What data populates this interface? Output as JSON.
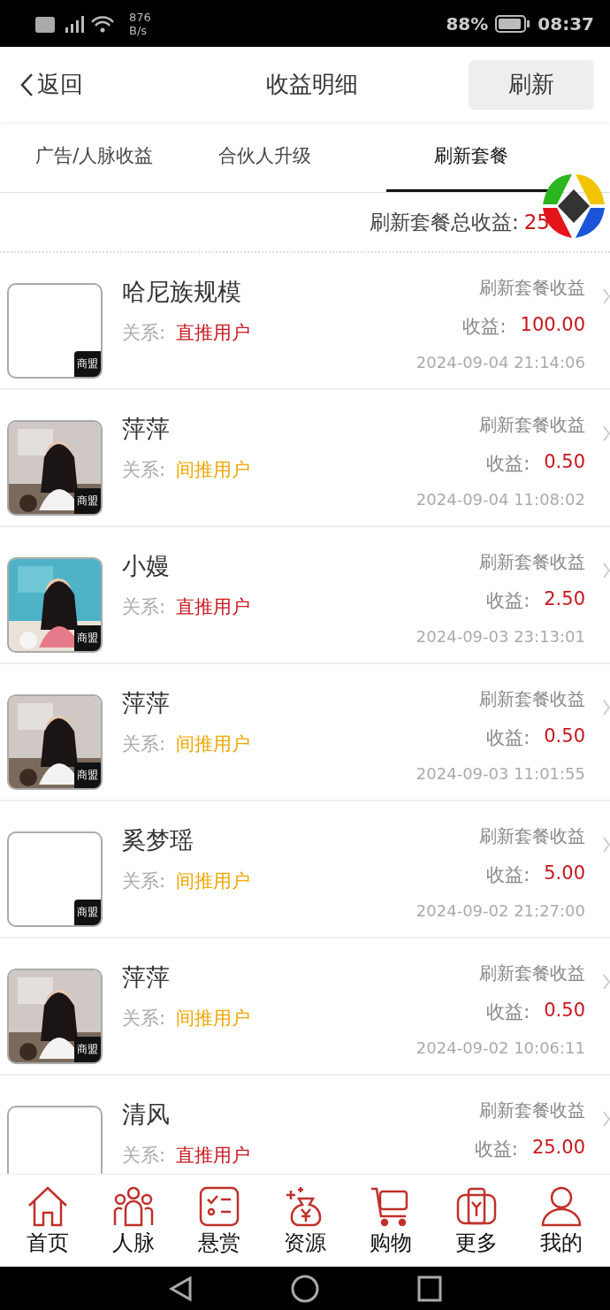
{
  "status_bar": {
    "net_speed": "876",
    "net_unit": "B/s",
    "battery": "88%",
    "time": "08:37"
  },
  "header": {
    "back": "返回",
    "title": "收益明细",
    "action": "刷新"
  },
  "tabs": [
    {
      "label": "广告/人脉收益",
      "selected": false
    },
    {
      "label": "合伙人升级",
      "selected": false
    },
    {
      "label": "刷新套餐",
      "selected": true
    }
  ],
  "total": {
    "label": "刷新套餐总收益:",
    "value": "25"
  },
  "rows": [
    {
      "name": "哈尼族规模",
      "badge": "商盟",
      "relation_label": "关系:",
      "relation": "直推用户",
      "color": "#c8161d",
      "type": "刷新套餐收益",
      "amount_label": "收益:",
      "amount": "100.00",
      "time": "2024-09-04 21:14:06"
    },
    {
      "name": "萍萍",
      "kind": "picture",
      "badge": "商盟",
      "relation_label": "关系:",
      "relation": "间推用户",
      "color": "#f0a500",
      "type": "刷新套餐收益",
      "amount_label": "收益:",
      "amount": "0.50",
      "time": "2024-09-04 11:08:02"
    },
    {
      "name": "小嫚",
      "kind": "picture",
      "badge": "商盟",
      "relation_label": "关系:",
      "relation": "直推用户",
      "color": "#c8161d",
      "type": "刷新套餐收益",
      "amount_label": "收益:",
      "amount": "2.50",
      "time": "2024-09-03 23:13:01"
    },
    {
      "name": "萍萍",
      "kind": "picture",
      "badge": "商盟",
      "relation_label": "关系:",
      "relation": "间推用户",
      "color": "#f0a500",
      "type": "刷新套餐收益",
      "amount_label": "收益:",
      "amount": "0.50",
      "time": "2024-09-03 11:01:55"
    },
    {
      "name": "奚梦瑶",
      "badge": "商盟",
      "relation_label": "关系:",
      "relation": "间推用户",
      "color": "#f0a500",
      "type": "刷新套餐收益",
      "amount_label": "收益:",
      "amount": "5.00",
      "time": "2024-09-02 21:27:00"
    },
    {
      "name": "萍萍",
      "kind": "picture",
      "badge": "商盟",
      "relation_label": "关系:",
      "relation": "间推用户",
      "color": "#f0a500",
      "type": "刷新套餐收益",
      "amount_label": "收益:",
      "amount": "0.50",
      "time": "2024-09-02 10:06:11"
    },
    {
      "name": "清风",
      "relation_label": "关系:",
      "relation": "直推用户",
      "color": "#c8161d",
      "type": "刷新套餐收益",
      "amount_label": "收益:",
      "amount": "25.00"
    }
  ],
  "nav": [
    {
      "label": "首页"
    },
    {
      "label": "人脉"
    },
    {
      "label": "悬赏"
    },
    {
      "label": "资源"
    },
    {
      "label": "购物"
    },
    {
      "label": "更多"
    },
    {
      "label": "我的"
    }
  ]
}
